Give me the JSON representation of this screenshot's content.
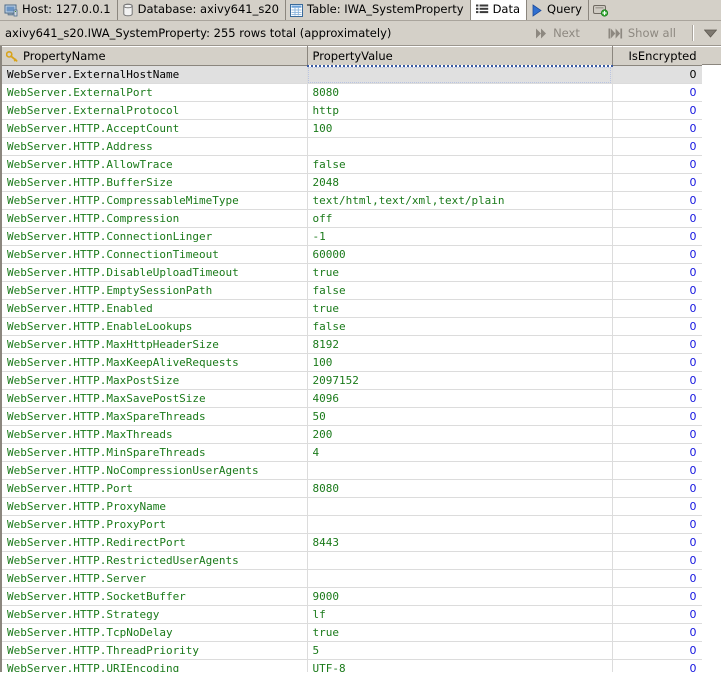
{
  "toolbar": {
    "items": [
      {
        "icon": "host-icon",
        "label": "Host: 127.0.0.1",
        "active": false
      },
      {
        "icon": "database-icon",
        "label": "Database: axivy641_s20",
        "active": false
      },
      {
        "icon": "table-icon",
        "label": "Table: IWA_SystemProperty",
        "active": false
      },
      {
        "icon": "data-grid-icon",
        "label": "Data",
        "active": true
      },
      {
        "icon": "query-play-icon",
        "label": "Query",
        "active": false
      },
      {
        "icon": "new-connection-icon",
        "label": "",
        "active": false
      }
    ]
  },
  "statusbar": {
    "text": "axivy641_s20.IWA_SystemProperty: 255 rows total (approximately)",
    "next_label": "Next",
    "next_icon": "next-arrow-icon",
    "show_all_label": "Show all",
    "show_all_icon": "show-all-icon",
    "dropdown_icon": "chevron-down-icon"
  },
  "grid": {
    "columns": [
      {
        "key": "PropertyName",
        "label": "PropertyName",
        "icon": "key-icon"
      },
      {
        "key": "PropertyValue",
        "label": "PropertyValue",
        "icon": ""
      },
      {
        "key": "IsEncrypted",
        "label": "IsEncrypted",
        "icon": ""
      }
    ],
    "rows": [
      {
        "name": "WebServer.ExternalHostName",
        "value": "",
        "enc": "0",
        "selected": true
      },
      {
        "name": "WebServer.ExternalPort",
        "value": "8080",
        "enc": "0"
      },
      {
        "name": "WebServer.ExternalProtocol",
        "value": "http",
        "enc": "0"
      },
      {
        "name": "WebServer.HTTP.AcceptCount",
        "value": "100",
        "enc": "0"
      },
      {
        "name": "WebServer.HTTP.Address",
        "value": "",
        "enc": "0"
      },
      {
        "name": "WebServer.HTTP.AllowTrace",
        "value": "false",
        "enc": "0"
      },
      {
        "name": "WebServer.HTTP.BufferSize",
        "value": "2048",
        "enc": "0"
      },
      {
        "name": "WebServer.HTTP.CompressableMimeType",
        "value": "text/html,text/xml,text/plain",
        "enc": "0"
      },
      {
        "name": "WebServer.HTTP.Compression",
        "value": "off",
        "enc": "0"
      },
      {
        "name": "WebServer.HTTP.ConnectionLinger",
        "value": "-1",
        "enc": "0"
      },
      {
        "name": "WebServer.HTTP.ConnectionTimeout",
        "value": "60000",
        "enc": "0"
      },
      {
        "name": "WebServer.HTTP.DisableUploadTimeout",
        "value": "true",
        "enc": "0"
      },
      {
        "name": "WebServer.HTTP.EmptySessionPath",
        "value": "false",
        "enc": "0"
      },
      {
        "name": "WebServer.HTTP.Enabled",
        "value": "true",
        "enc": "0"
      },
      {
        "name": "WebServer.HTTP.EnableLookups",
        "value": "false",
        "enc": "0"
      },
      {
        "name": "WebServer.HTTP.MaxHttpHeaderSize",
        "value": "8192",
        "enc": "0"
      },
      {
        "name": "WebServer.HTTP.MaxKeepAliveRequests",
        "value": "100",
        "enc": "0"
      },
      {
        "name": "WebServer.HTTP.MaxPostSize",
        "value": "2097152",
        "enc": "0"
      },
      {
        "name": "WebServer.HTTP.MaxSavePostSize",
        "value": "4096",
        "enc": "0"
      },
      {
        "name": "WebServer.HTTP.MaxSpareThreads",
        "value": "50",
        "enc": "0"
      },
      {
        "name": "WebServer.HTTP.MaxThreads",
        "value": "200",
        "enc": "0"
      },
      {
        "name": "WebServer.HTTP.MinSpareThreads",
        "value": "4",
        "enc": "0"
      },
      {
        "name": "WebServer.HTTP.NoCompressionUserAgents",
        "value": "",
        "enc": "0"
      },
      {
        "name": "WebServer.HTTP.Port",
        "value": "8080",
        "enc": "0"
      },
      {
        "name": "WebServer.HTTP.ProxyName",
        "value": "",
        "enc": "0"
      },
      {
        "name": "WebServer.HTTP.ProxyPort",
        "value": "",
        "enc": "0"
      },
      {
        "name": "WebServer.HTTP.RedirectPort",
        "value": "8443",
        "enc": "0"
      },
      {
        "name": "WebServer.HTTP.RestrictedUserAgents",
        "value": "",
        "enc": "0"
      },
      {
        "name": "WebServer.HTTP.Server",
        "value": "",
        "enc": "0"
      },
      {
        "name": "WebServer.HTTP.SocketBuffer",
        "value": "9000",
        "enc": "0"
      },
      {
        "name": "WebServer.HTTP.Strategy",
        "value": "lf",
        "enc": "0"
      },
      {
        "name": "WebServer.HTTP.TcpNoDelay",
        "value": "true",
        "enc": "0"
      },
      {
        "name": "WebServer.HTTP.ThreadPriority",
        "value": "5",
        "enc": "0"
      },
      {
        "name": "WebServer.HTTP.URIEncoding",
        "value": "UTF-8",
        "enc": "0"
      }
    ]
  },
  "colors": {
    "chrome": "#d4d0c8",
    "text_value": "#1a7a1a",
    "number": "#1515e0",
    "selection": "#0a1f63",
    "selected_row": "#e0e0e0"
  }
}
